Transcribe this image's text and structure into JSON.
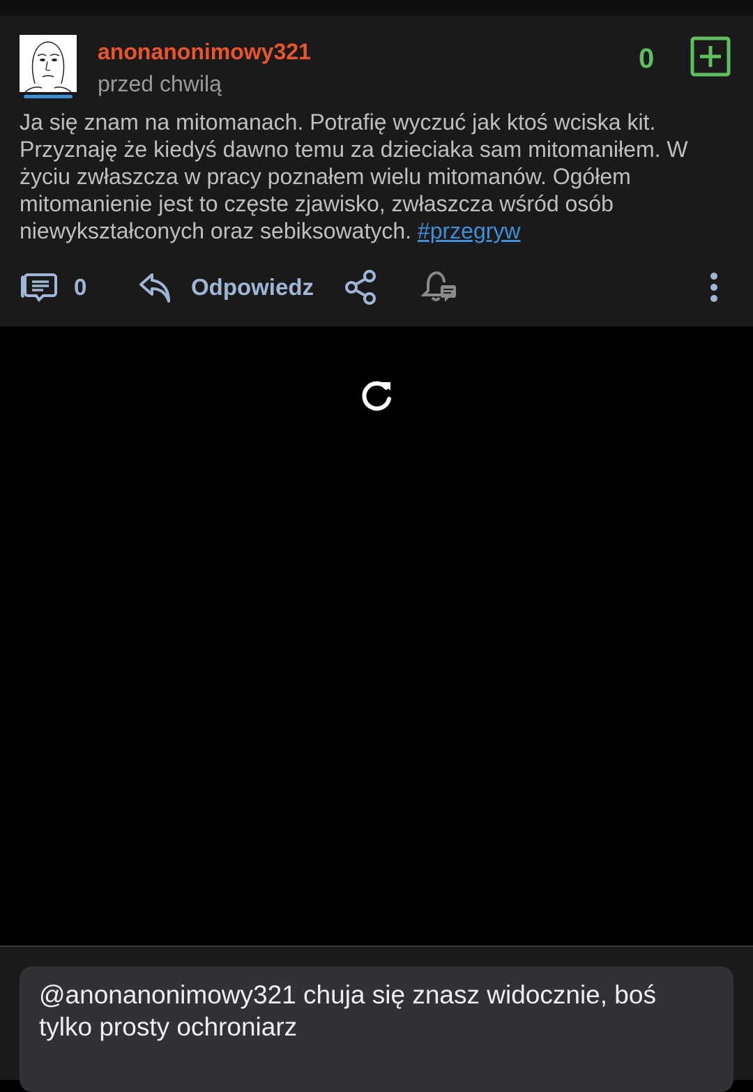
{
  "post": {
    "author": "anonanonimowy321",
    "time": "przed chwilą",
    "vote_count": "0",
    "content_text": "Ja się znam na mitomanach. Potrafię wyczuć jak ktoś wciska kit. Przyznaję że kiedyś dawno temu za dzieciaka sam mitomaniłem. W życiu zwłaszcza w pracy poznałem wielu mitomanów. Ogółem mitomanienie jest to częste zjawisko, zwłaszcza wśród osób niewykształconych oraz sebiksowatych. ",
    "tag": "#przegryw",
    "actions": {
      "comment_count": "0",
      "reply_label": "Odpowiedz"
    }
  },
  "reply": {
    "text": "@anonanonimowy321 chuja się znasz widocznie, boś tylko prosty ochroniarz"
  },
  "colors": {
    "author": "#e8552a",
    "vote": "#5fbf5f",
    "link": "#3f8fd8",
    "action": "#9fb6d6"
  },
  "icons": [
    "avatar-face-icon",
    "plus-box-icon",
    "comments-icon",
    "reply-arrow-icon",
    "share-icon",
    "bell-comment-icon",
    "more-vert-icon",
    "reload-icon"
  ]
}
